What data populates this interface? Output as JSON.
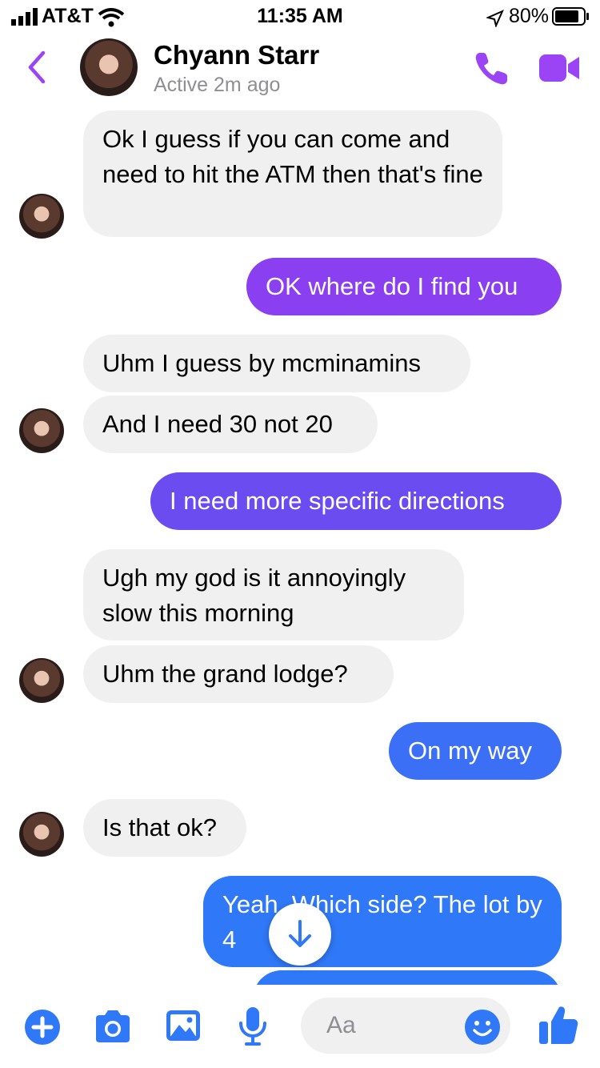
{
  "status_bar": {
    "carrier": "AT&T",
    "time": "11:35 AM",
    "battery": "80%"
  },
  "header": {
    "contact_name": "Chyann Starr",
    "presence": "Active 2m ago",
    "accent_color": "#9b44f5"
  },
  "messages": [
    {
      "dir": "in",
      "text": "Ok I guess if you can come and need to hit the ATM then that's fine"
    },
    {
      "dir": "out",
      "text": "OK where do I find you",
      "color": "#8a3ff0"
    },
    {
      "dir": "in",
      "text": "Uhm I guess by mcminamins"
    },
    {
      "dir": "in",
      "text": "And I need 30 not 20"
    },
    {
      "dir": "out",
      "text": "I need more specific directions",
      "color": "#6b4cf0"
    },
    {
      "dir": "in",
      "text": "Ugh my god is it annoyingly slow this morning"
    },
    {
      "dir": "in",
      "text": "Uhm the grand lodge?"
    },
    {
      "dir": "out",
      "text": "On my way",
      "color": "#3b6ff5"
    },
    {
      "dir": "in",
      "text": "Is that ok?"
    },
    {
      "dir": "out",
      "text": "Yeah. Which side? The lot by 4",
      "color": "#2f78f7"
    }
  ],
  "composer": {
    "placeholder": "Aa",
    "icons": [
      "plus-icon",
      "camera-icon",
      "gallery-icon",
      "microphone-icon",
      "emoji-icon",
      "thumbs-up-icon"
    ],
    "icon_color": "#2f78f7"
  }
}
